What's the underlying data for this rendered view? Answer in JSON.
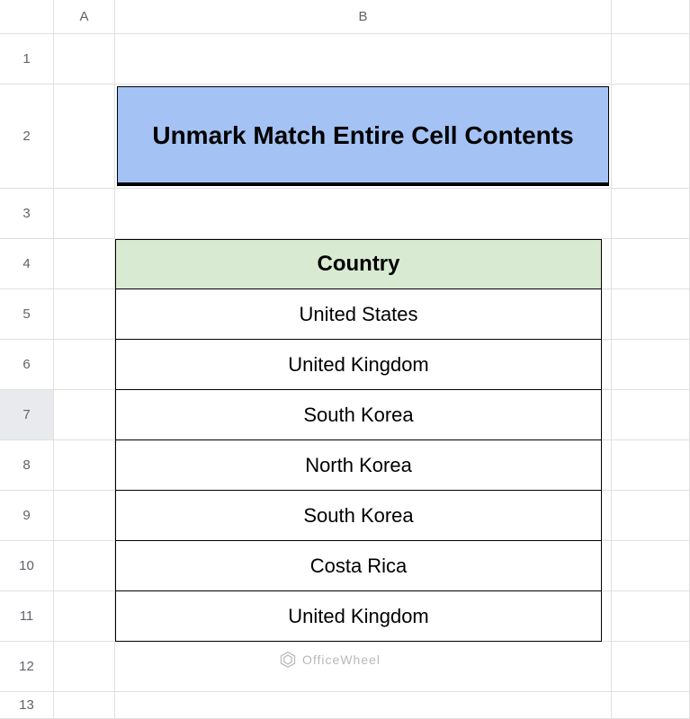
{
  "columns": [
    "A",
    "B"
  ],
  "rows": [
    "1",
    "2",
    "3",
    "4",
    "5",
    "6",
    "7",
    "8",
    "9",
    "10",
    "11",
    "12",
    "13"
  ],
  "selected_row": "7",
  "title": "Unmark Match Entire Cell Contents",
  "table": {
    "header": "Country",
    "rows": [
      "United States",
      "United Kingdom",
      "South Korea",
      "North Korea",
      "South Korea",
      "Costa Rica",
      "United Kingdom"
    ]
  },
  "watermark": "OfficeWheel",
  "chart_data": {
    "type": "table",
    "title": "Unmark Match Entire Cell Contents",
    "columns": [
      "Country"
    ],
    "rows": [
      [
        "United States"
      ],
      [
        "United Kingdom"
      ],
      [
        "South Korea"
      ],
      [
        "North Korea"
      ],
      [
        "South Korea"
      ],
      [
        "Costa Rica"
      ],
      [
        "United Kingdom"
      ]
    ]
  }
}
